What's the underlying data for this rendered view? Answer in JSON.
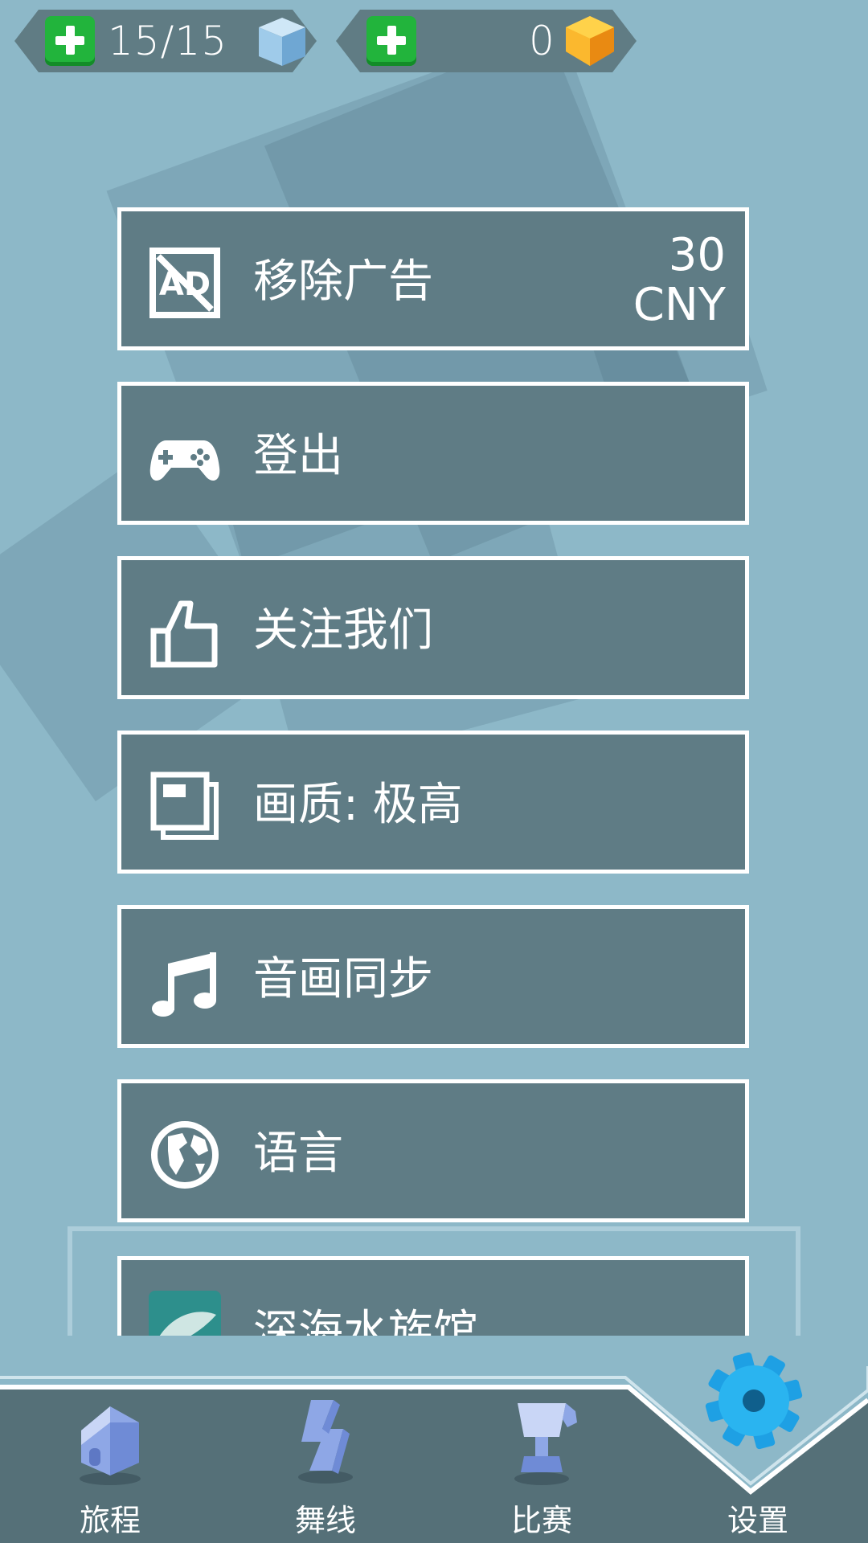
{
  "top_bar": {
    "energy": {
      "value": "15/15",
      "icon": "blue-cube-icon",
      "add_icon": "plus-icon"
    },
    "gems": {
      "value": "0",
      "icon": "gold-gem-icon",
      "add_icon": "plus-icon"
    }
  },
  "menu": {
    "items": [
      {
        "id": "remove-ads",
        "label": "移除广告",
        "icon": "no-ads-icon",
        "price_amount": "30",
        "price_currency": "CNY"
      },
      {
        "id": "logout",
        "label": "登出",
        "icon": "gamepad-icon"
      },
      {
        "id": "follow-us",
        "label": "关注我们",
        "icon": "thumbs-up-icon"
      },
      {
        "id": "quality",
        "label": "画质: 极高",
        "icon": "graphics-quality-icon"
      },
      {
        "id": "av-sync",
        "label": "音画同步",
        "icon": "music-note-icon"
      },
      {
        "id": "language",
        "label": "语言",
        "icon": "globe-icon"
      },
      {
        "id": "deep-sea-aquarium",
        "label": "深海水族馆",
        "icon": "whale-thumbnail-icon"
      }
    ]
  },
  "bottom_nav": {
    "tabs": [
      {
        "label": "旅程",
        "icon": "house-icon"
      },
      {
        "label": "舞线",
        "icon": "dance-line-icon"
      },
      {
        "label": "比赛",
        "icon": "trophy-icon"
      },
      {
        "label": "设置",
        "icon": "gear-icon",
        "active": true
      }
    ]
  },
  "colors": {
    "background": "#8db8c8",
    "panel": "#5f7c85",
    "nav": "#557078",
    "accent_gear": "#1fa6e8",
    "plus_green": "#22b43c"
  }
}
